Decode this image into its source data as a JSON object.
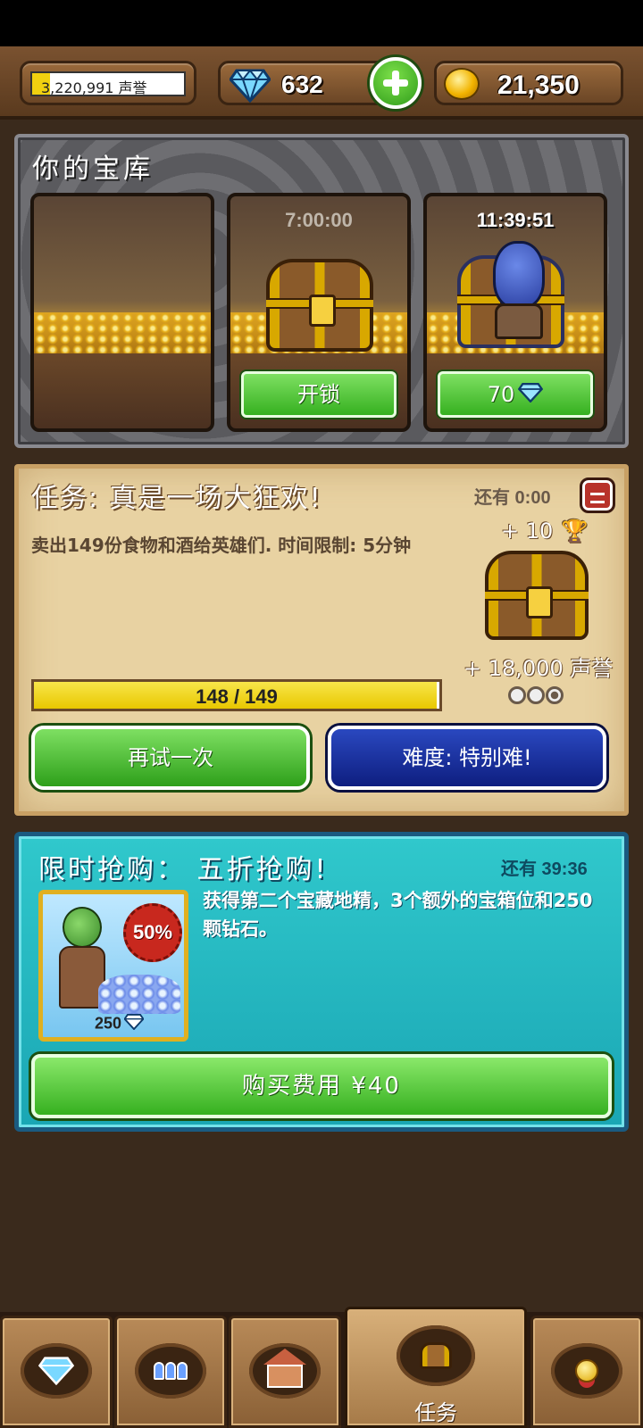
{
  "topbar": {
    "reputation": {
      "value_text": "3,220,991 声誉",
      "progress": 0.12
    },
    "gems": {
      "value": "632",
      "icon": "diamond-icon"
    },
    "add_button_icon": "plus-icon",
    "gold": {
      "value": "21,350",
      "icon": "gold-coin-icon"
    }
  },
  "treasury": {
    "title": "你的宝库",
    "slots": [
      {
        "state": "empty",
        "timer": ""
      },
      {
        "state": "locked",
        "timer": "7:00:00",
        "button_label": "开锁"
      },
      {
        "state": "unlocking",
        "timer": "11:39:51",
        "button_label": "70"
      }
    ]
  },
  "quest": {
    "title": "任务: 真是一场大狂欢!",
    "remaining": "还有 0:00",
    "description": "卖出149份食物和酒给英雄们. 时间限制: 5分钟",
    "reward_trophies": "+ 10",
    "reward_reputation": "+ 18,000 声誉",
    "progress_text": "148 / 149",
    "progress": 0.993,
    "stars_filled": 1,
    "stars_total": 3,
    "retry_label": "再试一次",
    "difficulty_label": "难度: 特别难!"
  },
  "sale": {
    "title": "限时抢购： 五折抢购!",
    "remaining": "还有 39:36",
    "badge": "50%",
    "gem_count": "250",
    "description": "获得第二个宝藏地精，3个额外的宝箱位和250颗钻石。",
    "buy_label": "购买费用 ¥40"
  },
  "nav": {
    "tabs": [
      {
        "name": "gems",
        "icon": "diamond-icon",
        "label": ""
      },
      {
        "name": "heroes",
        "icon": "people-icon",
        "label": ""
      },
      {
        "name": "tavern",
        "icon": "house-icon",
        "label": ""
      },
      {
        "name": "quests",
        "icon": "chest-icon",
        "label": "任务",
        "active": true
      },
      {
        "name": "achievements",
        "icon": "medal-icon",
        "label": ""
      }
    ]
  },
  "colors": {
    "accent_green": "#36b020",
    "accent_blue": "#0e1e80",
    "panel_parchment": "#e8d2a2",
    "panel_teal": "#1aa6b4"
  }
}
